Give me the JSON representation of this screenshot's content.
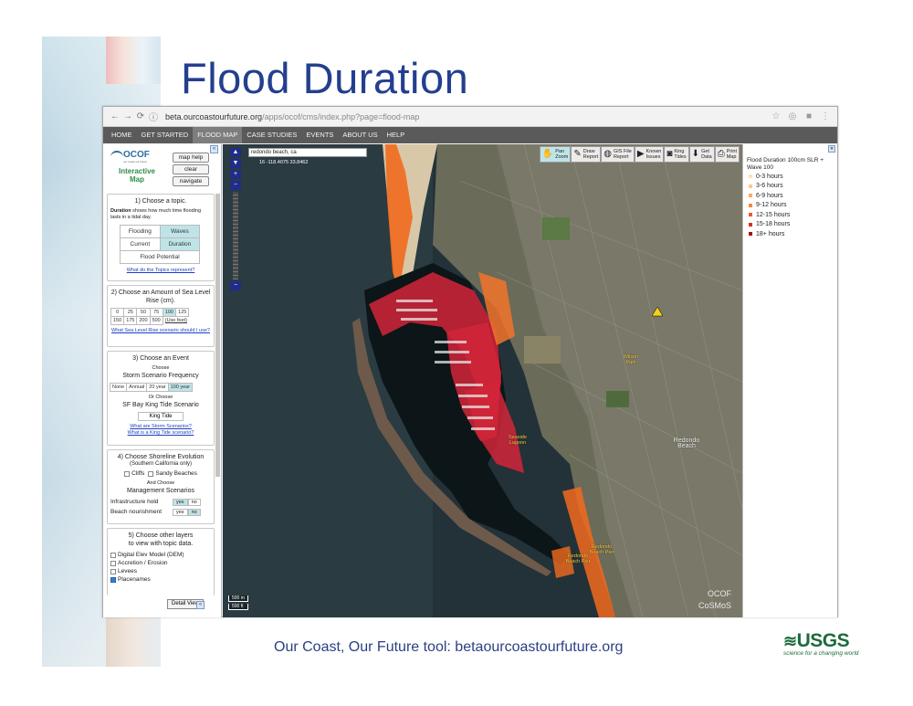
{
  "slide": {
    "title": "Flood Duration",
    "footer": "Our Coast, Our Future tool: betaourcoastourfuture.org",
    "usgs_logo": "USGS",
    "usgs_tagline": "science for a changing world"
  },
  "browser": {
    "url_host": "beta.ourcoastourfuture.org",
    "url_path": "/apps/ocof/cms/index.php?page=flood-map",
    "icons": [
      "back-icon",
      "forward-icon",
      "reload-icon",
      "info-icon",
      "star-icon",
      "menu-icon"
    ]
  },
  "nav": {
    "items": [
      "HOME",
      "GET STARTED",
      "FLOOD MAP",
      "CASE STUDIES",
      "EVENTS",
      "ABOUT US",
      "HELP"
    ],
    "active": "FLOOD MAP"
  },
  "left": {
    "logo_text": "OCOF",
    "logo_tag": "our coast our future",
    "app_name": "Interactive Map",
    "map_help": "map help",
    "clear": "clear",
    "navigate": "navigate",
    "step1_title": "1) Choose a topic.",
    "step1_desc_bold": "Duration",
    "step1_desc": " shows how much time flooding lasts in a tidal day.",
    "topics": [
      "Flooding",
      "Waves",
      "Current",
      "Duration",
      "Flood Potential"
    ],
    "step1_link": "What do the Topics represent?",
    "step2_title": "2) Choose an Amount of Sea Level Rise (cm).",
    "slr_row1": [
      "0",
      "25",
      "50",
      "75",
      "100",
      "125"
    ],
    "slr_row2": [
      "150",
      "175",
      "200",
      "500",
      "(Use feet)"
    ],
    "step2_link": "What Sea Level Rise scenario should I use?",
    "step3_title": "3) Choose an Event",
    "choose": "Choose",
    "storm_label": "Storm Scenario Frequency",
    "storm_options": [
      "None",
      "Annual",
      "20 year",
      "100 year"
    ],
    "or_choose": "Or Choose",
    "king_label": "SF Bay King Tide Scenario",
    "king_btn": "King Tide",
    "step3_link1": "What are Storm Scenarios?",
    "step3_link2": "What is a King Tide scenario?",
    "step4_title": "4) Choose Shoreline Evolution",
    "step4_sub": "(Southern California only)",
    "cliffs": "Cliffs",
    "sandy": "Sandy Beaches",
    "and_choose": "And Choose",
    "mgmt": "Management Scenarios",
    "infra": "Infrastructure hold",
    "beach": "Beach nourishment",
    "yes": "yes",
    "no": "no",
    "step5_title": "5) Choose other layers to view with topic data.",
    "layers": [
      "Digital Elev Model (DEM)",
      "Accretion / Erosion",
      "Levees",
      "Placenames"
    ],
    "detail_view": "Detail View"
  },
  "map": {
    "search_value": "redondo beach, ca",
    "coords": "16 -118.4075 33.8462",
    "tools": [
      {
        "label": "Pan\nZoom",
        "icon": "hand-icon"
      },
      {
        "label": "Draw\nReport",
        "icon": "pencil-icon"
      },
      {
        "label": "GIS File\nReport",
        "icon": "globe-icon"
      },
      {
        "label": "Known\nIssues",
        "icon": "flag-icon"
      },
      {
        "label": "King\nTides",
        "icon": "camera-icon"
      },
      {
        "label": "Get\nData",
        "icon": "download-icon"
      },
      {
        "label": "Print\nMap",
        "icon": "print-icon"
      }
    ],
    "scale_1": "500 m",
    "scale_2": "500 ft",
    "watermark_1": "OCOF",
    "watermark_2": "CoSMoS",
    "places": [
      "Redondo Beach",
      "Redondo Beach Pier",
      "Seaside Lagoon",
      "Redondo Beach Pier",
      "Wilson Park"
    ]
  },
  "legend": {
    "title": "Flood Duration 100cm SLR + Wave 100",
    "items": [
      {
        "label": "0-3 hours",
        "color": "#fde1b8"
      },
      {
        "label": "3-6 hours",
        "color": "#fcc98a"
      },
      {
        "label": "6-9 hours",
        "color": "#fbab63"
      },
      {
        "label": "9-12 hours",
        "color": "#f8873f"
      },
      {
        "label": "12-15 hours",
        "color": "#ee5a2a"
      },
      {
        "label": "15-18 hours",
        "color": "#d8301c"
      },
      {
        "label": "18+ hours",
        "color": "#a6120f"
      }
    ]
  }
}
